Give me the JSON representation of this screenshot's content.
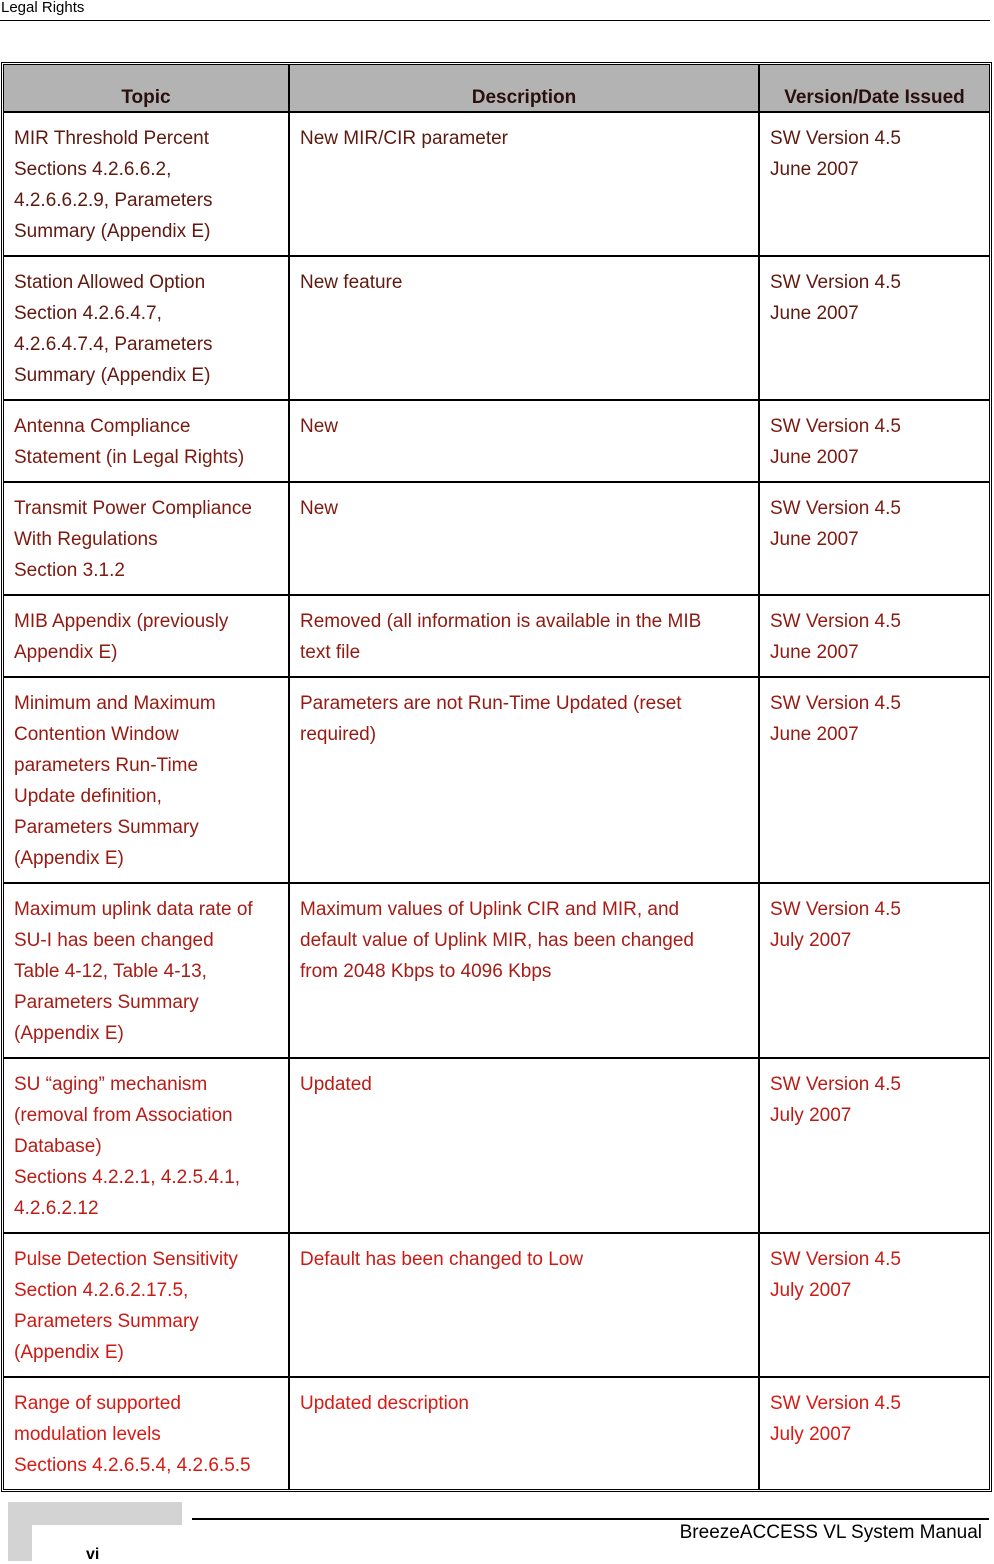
{
  "header": {
    "section_title": "Legal Rights"
  },
  "table": {
    "columns": [
      "Topic",
      "Description",
      "Version/Date Issued"
    ],
    "rows": [
      {
        "color": "#5c1a10",
        "topic": [
          "MIR Threshold Percent",
          "Sections 4.2.6.6.2,",
          "4.2.6.6.2.9, Parameters",
          "Summary (Appendix E)"
        ],
        "description": [
          "New MIR/CIR parameter"
        ],
        "version": [
          "SW Version 4.5",
          "June 2007"
        ]
      },
      {
        "color": "#601a10",
        "topic": [
          "Station Allowed Option",
          "Section 4.2.6.4.7,",
          "4.2.6.4.7.4, Parameters",
          "Summary (Appendix E)"
        ],
        "description": [
          "New feature"
        ],
        "version": [
          "SW Version 4.5",
          "June 2007"
        ]
      },
      {
        "color": "#7a1a10",
        "topic": [
          "Antenna Compliance",
          "Statement (in Legal Rights)"
        ],
        "description": [
          "New"
        ],
        "version": [
          "SW Version 4.5",
          "June 2007"
        ]
      },
      {
        "color": "#7e1a10",
        "topic": [
          "Transmit Power Compliance",
          "With Regulations",
          "Section 3.1.2"
        ],
        "description": [
          "New"
        ],
        "version": [
          "SW Version 4.5",
          "June 2007"
        ]
      },
      {
        "color": "#901a12",
        "topic": [
          "MIB Appendix (previously",
          "Appendix E)"
        ],
        "description": [
          "Removed (all information is available in the MIB",
          "text file"
        ],
        "version": [
          "SW Version 4.5",
          "June 2007"
        ]
      },
      {
        "color": "#961a12",
        "topic": [
          "Minimum and Maximum",
          "Contention Window",
          "parameters Run-Time",
          "Update definition,",
          "Parameters Summary",
          "(Appendix E)"
        ],
        "description": [
          "Parameters are not Run-Time Updated (reset",
          "required)"
        ],
        "version": [
          "SW Version 4.5",
          "June 2007"
        ]
      },
      {
        "color": "#a81c16",
        "topic": [
          "Maximum uplink data rate of",
          "SU-I has been changed",
          "Table 4-12, Table 4-13,",
          "Parameters Summary",
          "(Appendix E)"
        ],
        "description": [
          "Maximum values of Uplink CIR and MIR, and",
          "default value of Uplink MIR, has been changed",
          "from 2048 Kbps to 4096 Kbps"
        ],
        "version": [
          "SW Version 4.5",
          "July 2007"
        ]
      },
      {
        "color": "#b81c16",
        "topic": [
          "SU “aging” mechanism",
          "(removal from Association",
          "Database)",
          "Sections 4.2.2.1, 4.2.5.4.1,",
          "4.2.6.2.12"
        ],
        "description": [
          "Updated"
        ],
        "version": [
          "SW Version 4.5",
          "July 2007"
        ]
      },
      {
        "color": "#cc1a14",
        "topic": [
          "Pulse Detection Sensitivity",
          "Section 4.2.6.2.17.5,",
          "Parameters Summary",
          "(Appendix E)"
        ],
        "description": [
          "Default has been changed to Low"
        ],
        "version": [
          "SW Version 4.5",
          "July 2007"
        ]
      },
      {
        "color": "#d81a14",
        "topic": [
          "Range of supported",
          "modulation levels",
          "Sections 4.2.6.5.4, 4.2.6.5.5"
        ],
        "description": [
          "Updated description"
        ],
        "version": [
          "SW Version 4.5",
          "July 2007"
        ]
      }
    ]
  },
  "footer": {
    "page_number": "vi",
    "manual_title": "BreezeACCESS VL System Manual"
  }
}
